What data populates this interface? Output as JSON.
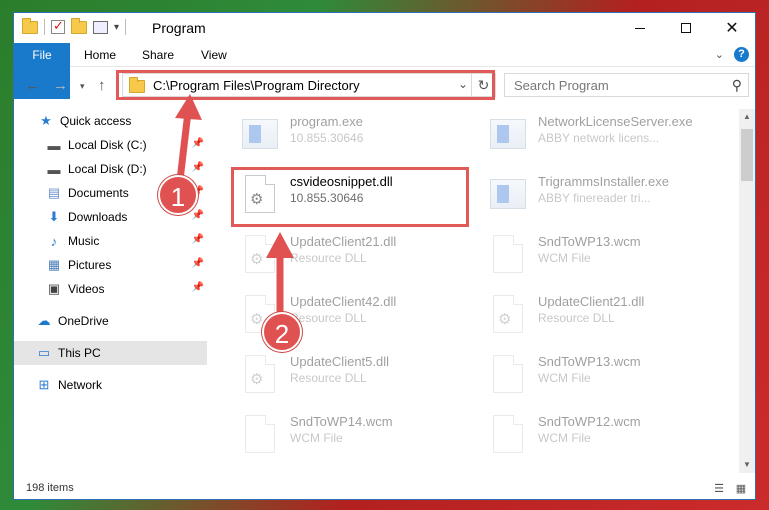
{
  "window": {
    "title": "Program",
    "controls": [
      "minimize",
      "maximize",
      "close"
    ]
  },
  "ribbon": {
    "tabs": [
      "File",
      "Home",
      "Share",
      "View"
    ]
  },
  "address": {
    "path": "C:\\Program Files\\Program Directory",
    "search_placeholder": "Search Program"
  },
  "sidebar": {
    "items": [
      {
        "label": "Quick access",
        "icon": "star-icon",
        "pinned": false
      },
      {
        "label": "Local Disk (C:)",
        "icon": "drive-icon",
        "pinned": true
      },
      {
        "label": "Local Disk (D:)",
        "icon": "drive-icon",
        "pinned": true
      },
      {
        "label": "Documents",
        "icon": "documents-icon",
        "pinned": true
      },
      {
        "label": "Downloads",
        "icon": "downloads-icon",
        "pinned": true
      },
      {
        "label": "Music",
        "icon": "music-icon",
        "pinned": true
      },
      {
        "label": "Pictures",
        "icon": "pictures-icon",
        "pinned": true
      },
      {
        "label": "Videos",
        "icon": "videos-icon",
        "pinned": true
      },
      {
        "label": "OneDrive",
        "icon": "cloud-icon",
        "pinned": false
      },
      {
        "label": "This PC",
        "icon": "computer-icon",
        "pinned": false,
        "selected": true
      },
      {
        "label": "Network",
        "icon": "network-icon",
        "pinned": false
      }
    ]
  },
  "files": [
    {
      "name": "program.exe",
      "desc": "10.855.30646",
      "icon": "exe-icon",
      "faded": true
    },
    {
      "name": "NetworkLicenseServer.exe",
      "desc": "ABBY network licens...",
      "icon": "exe-icon",
      "faded": true
    },
    {
      "name": "csvideosnippet.dll",
      "desc": "10.855.30646",
      "icon": "dll-icon",
      "faded": false
    },
    {
      "name": "TrigrammsInstaller.exe",
      "desc": "ABBY finereader tri...",
      "icon": "exe-icon",
      "faded": true
    },
    {
      "name": "UpdateClient21.dll",
      "desc": "Resource DLL",
      "icon": "dll-icon",
      "faded": true
    },
    {
      "name": "SndToWP13.wcm",
      "desc": "WCM File",
      "icon": "file-icon",
      "faded": true
    },
    {
      "name": "UpdateClient42.dll",
      "desc": "Resource DLL",
      "icon": "dll-icon",
      "faded": true
    },
    {
      "name": "UpdateClient21.dll",
      "desc": "Resource DLL",
      "icon": "dll-icon",
      "faded": true
    },
    {
      "name": "UpdateClient5.dll",
      "desc": "Resource DLL",
      "icon": "dll-icon",
      "faded": true
    },
    {
      "name": "SndToWP13.wcm",
      "desc": "WCM File",
      "icon": "file-icon",
      "faded": true
    },
    {
      "name": "SndToWP14.wcm",
      "desc": "WCM File",
      "icon": "file-icon",
      "faded": true
    },
    {
      "name": "SndToWP12.wcm",
      "desc": "WCM File",
      "icon": "file-icon",
      "faded": true
    }
  ],
  "status": {
    "item_count": "198 items"
  },
  "annotations": {
    "step1": "1",
    "step2": "2",
    "color": "#e05252"
  }
}
